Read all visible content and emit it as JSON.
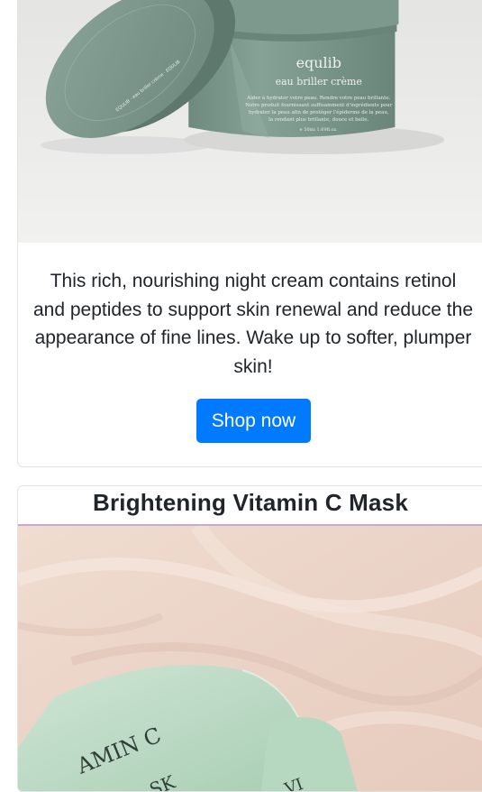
{
  "cards": [
    {
      "image": {
        "brand": "equlib",
        "product_name": "eau briller crème",
        "lid_text": "EQULIB · eau briller crème · EQULIB",
        "label_lines": [
          "Aider à hydrater votre peau. Rendre votre peau brillante.",
          "Notre produit fournissant suffisamment d'ingrédients pour",
          "hydrater la peau afin de protéger l'épiderme de la peau,",
          "la rendant plus brillante, douce et belle.",
          "℮ 50ml 1.69fl.oz."
        ]
      },
      "description": "This rich, nourishing night cream contains retinol and peptides to support skin renewal and reduce the appearance of fine lines. Wake up to softer, plumper skin!",
      "button_label": "Shop now"
    },
    {
      "title": "Brightening Vitamin C Mask",
      "image": {
        "packet_text_1": "AMIN C",
        "packet_text_2": "SK",
        "packet_text_3": "VI"
      }
    }
  ],
  "colors": {
    "button": "#007bff",
    "jar": "#7f9b8f",
    "fabric": "#ecd5c8",
    "packet": "#bcdcc6"
  }
}
